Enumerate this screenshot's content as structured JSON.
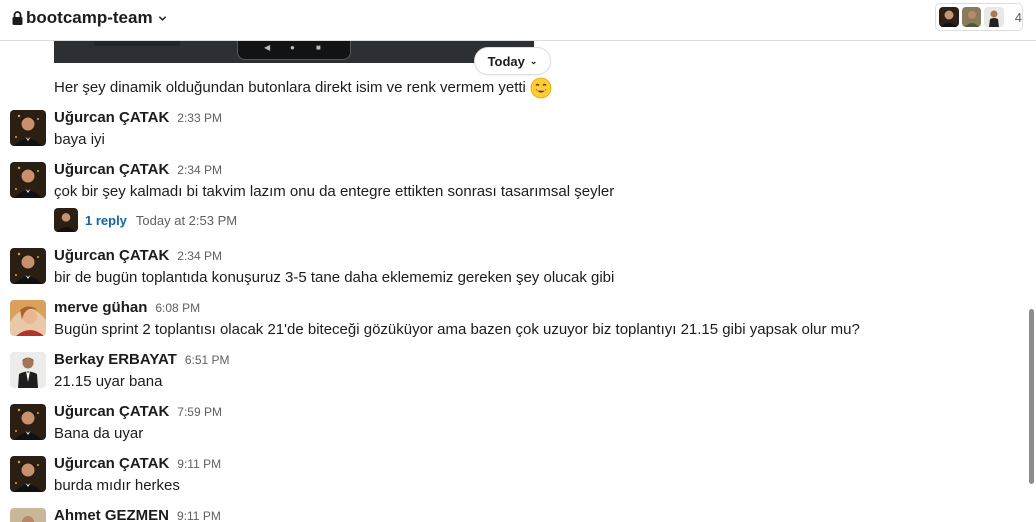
{
  "header": {
    "channel_name": "bootcamp-team",
    "member_count": "4"
  },
  "date_divider": {
    "label": "Today"
  },
  "continuation": {
    "text": "Her şey dinamik olduğundan butonlara direkt isim ve renk vermem yetti",
    "emoji": "grinning-face-with-smiling-eyes"
  },
  "messages": [
    {
      "sender": "Uğurcan ÇATAK",
      "time": "2:33 PM",
      "text": "baya iyi"
    },
    {
      "sender": "Uğurcan ÇATAK",
      "time": "2:34 PM",
      "text": "çok bir şey kalmadı bi takvim lazım onu da entegre ettikten sonrası tasarımsal şeyler",
      "thread": {
        "replies": "1 reply",
        "last_reply": "Today at 2:53 PM"
      }
    },
    {
      "sender": "Uğurcan ÇATAK",
      "time": "2:34 PM",
      "text": "bir de bugün toplantıda konuşuruz 3-5 tane daha eklememiz gereken şey olucak gibi"
    },
    {
      "sender": "merve gühan",
      "time": "6:08 PM",
      "text": "Bugün sprint 2 toplantısı olacak 21'de biteceği gözüküyor ama bazen çok uzuyor biz toplantıyı 21.15 gibi yapsak olur mu?"
    },
    {
      "sender": "Berkay ERBAYAT",
      "time": "6:51 PM",
      "text": "21.15 uyar bana"
    },
    {
      "sender": "Uğurcan ÇATAK",
      "time": "7:59 PM",
      "text": "Bana da uyar"
    },
    {
      "sender": "Uğurcan ÇATAK",
      "time": "9:11 PM",
      "text": "burda mıdır herkes"
    },
    {
      "sender": "Ahmet GEZMEN",
      "time": "9:11 PM",
      "text": ""
    }
  ],
  "colors": {
    "link": "#1264a3",
    "muted": "#616061",
    "text": "#1d1c1d",
    "border": "#dddddd"
  }
}
